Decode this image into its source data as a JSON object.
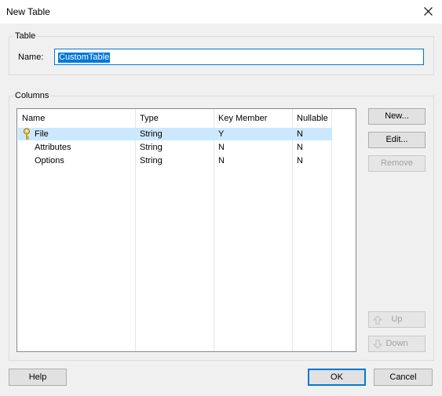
{
  "window": {
    "title": "New Table"
  },
  "table_group": {
    "label": "Table",
    "name_label": "Name:",
    "name_value": "CustomTable"
  },
  "columns_group": {
    "label": "Columns",
    "headers": [
      "Name",
      "Type",
      "Key Member",
      "Nullable"
    ],
    "rows": [
      {
        "name": "File",
        "type": "String",
        "key": "Y",
        "nullable": "N",
        "selected": true,
        "icon": "key-icon"
      },
      {
        "name": "Attributes",
        "type": "String",
        "key": "N",
        "nullable": "N"
      },
      {
        "name": "Options",
        "type": "String",
        "key": "N",
        "nullable": "N"
      }
    ]
  },
  "side_buttons": {
    "new": "New...",
    "edit": "Edit...",
    "remove": "Remove",
    "up": "Up",
    "down": "Down"
  },
  "footer": {
    "help": "Help",
    "ok": "OK",
    "cancel": "Cancel"
  },
  "colors": {
    "accent": "#0078d7",
    "selection": "#cce8ff",
    "disabled_text": "#a0a0a0"
  }
}
